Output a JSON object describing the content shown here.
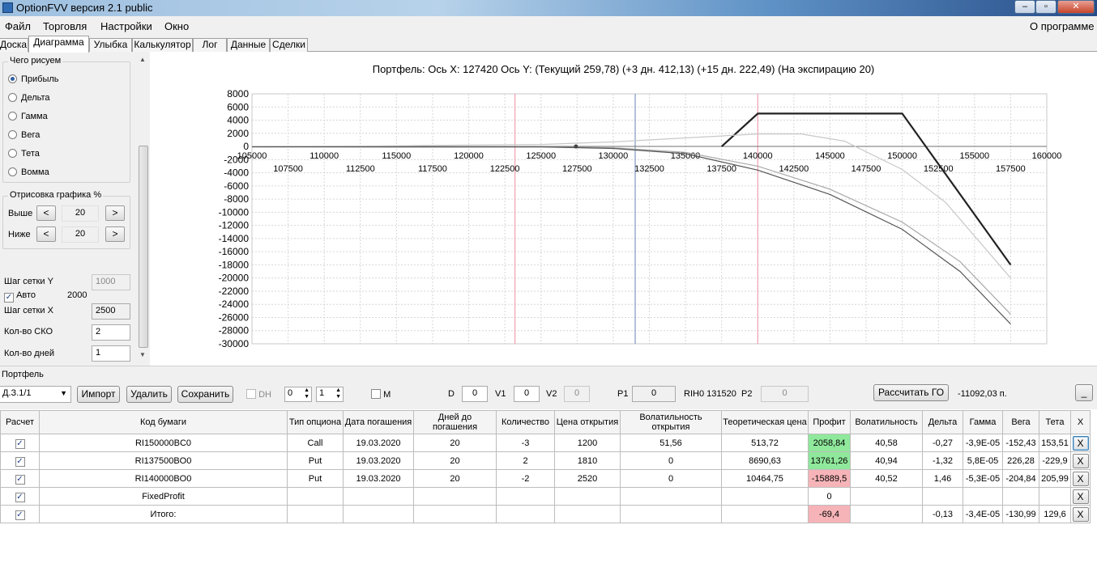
{
  "window": {
    "title": "OptionFVV версия 2.1 public",
    "min": "–",
    "max": "▫",
    "close": "✕"
  },
  "menu": {
    "items": [
      "Файл",
      "Торговля",
      "Настройки",
      "Окно"
    ],
    "about": "О программе"
  },
  "tabs": [
    "Доска",
    "Диаграмма",
    "Улыбка",
    "Калькулятор",
    "Лог",
    "Данные",
    "Сделки"
  ],
  "active_tab": "Диаграмма",
  "left_panel": {
    "draw_group_title": "Чего рисуем",
    "options": [
      "Прибыль",
      "Дельта",
      "Гамма",
      "Вега",
      "Тета",
      "Вомма"
    ],
    "selected": "Прибыль",
    "render_group_title": "Отрисовка графика %",
    "above_label": "Выше",
    "above_value": "20",
    "below_label": "Ниже",
    "below_value": "20",
    "btn_less": "<",
    "btn_more": ">",
    "grid_y_label": "Шаг сетки Y",
    "grid_y_value": "1000",
    "auto_label": "Авто",
    "auto_value": "2000",
    "grid_x_label": "Шаг сетки X",
    "grid_x_value": "2500",
    "sko_label": "Кол-во СКО",
    "sko_value": "2",
    "days_label": "Кол-во дней",
    "days_value": "1"
  },
  "chart_data": {
    "type": "line",
    "title": "Портфель: Ось X: 127420 Ось Y:  (Текущий 259,78)  (+3 дн. 412,13)  (+15 дн. 222,49)  (На экспирацию 20)",
    "xlabel": "",
    "ylabel": "",
    "xlim": [
      105000,
      160000
    ],
    "ylim": [
      -30000,
      8000
    ],
    "x_ticks_upper": [
      "105000",
      "110000",
      "115000",
      "120000",
      "125000",
      "130000",
      "135000",
      "140000",
      "145000",
      "150000",
      "155000",
      "160000"
    ],
    "x_ticks_lower": [
      "107500",
      "112500",
      "117500",
      "122500",
      "127500",
      "132500",
      "137500",
      "142500",
      "147500",
      "152500",
      "157500"
    ],
    "y_ticks": [
      "8000",
      "6000",
      "4000",
      "2000",
      "0",
      "-2000",
      "-4000",
      "-6000",
      "-8000",
      "-10000",
      "-12000",
      "-14000",
      "-16000",
      "-18000",
      "-20000",
      "-22000",
      "-24000",
      "-26000",
      "-28000",
      "-30000"
    ],
    "grid": true,
    "vlines": [
      {
        "x": 123200,
        "color": "#f4a0b0"
      },
      {
        "x": 131520,
        "color": "#7f98c0"
      },
      {
        "x": 140000,
        "color": "#f4a0b0"
      }
    ],
    "series": [
      {
        "color": "#222222",
        "x": [
          137500,
          140000,
          150000,
          157500
        ],
        "y": [
          0,
          5000,
          5000,
          -18000
        ]
      },
      {
        "color": "#c8c8c8",
        "x": [
          105000,
          115000,
          125000,
          130000,
          135000,
          140000,
          143000,
          146000,
          150000,
          153000,
          157500
        ],
        "y": [
          0,
          100,
          300,
          700,
          1300,
          1900,
          1900,
          800,
          -3500,
          -8500,
          -20000
        ]
      },
      {
        "color": "#a8a8a8",
        "x": [
          105000,
          115000,
          125000,
          130000,
          135000,
          140000,
          145000,
          150000,
          154000,
          157500
        ],
        "y": [
          -50,
          -60,
          -50,
          -200,
          -900,
          -3000,
          -6500,
          -11500,
          -17500,
          -25500
        ]
      },
      {
        "color": "#555555",
        "x": [
          105000,
          115000,
          125000,
          130000,
          135000,
          140000,
          145000,
          150000,
          154000,
          157500
        ],
        "y": [
          -50,
          -70,
          -80,
          -300,
          -1100,
          -3600,
          -7300,
          -12600,
          -19000,
          -27000
        ]
      }
    ]
  },
  "portfolio": {
    "section_label": "Портфель",
    "select_value": "Д.З.1/1",
    "import_label": "Импорт",
    "delete_label": "Удалить",
    "save_label": "Сохранить",
    "dh_label": "DH",
    "dh_spin1": "0",
    "dh_spin2": "1",
    "m_label": "M",
    "d_label": "D",
    "d_value": "0",
    "v1_label": "V1",
    "v1_value": "0",
    "v2_label": "V2",
    "v2_value": "0",
    "p1_label": "P1",
    "p1_value": "0",
    "rih_label": "RIH0 131520",
    "p2_label": "P2",
    "p2_value": "0",
    "calc_go_label": "Рассчитать ГО",
    "go_value": "-11092,03 п.",
    "collapse_label": "_"
  },
  "table": {
    "headers": [
      "Расчет",
      "Код бумаги",
      "Тип опциона",
      "Дата погашения",
      "Дней до погашения",
      "Количество",
      "Цена открытия",
      "Волатильность открытия",
      "Теоретическая цена",
      "Профит",
      "Волатильность",
      "Дельта",
      "Гамма",
      "Вега",
      "Тета",
      "X"
    ],
    "rows": [
      {
        "code": "RI150000BC0",
        "type": "Call",
        "date": "19.03.2020",
        "days": "20",
        "qty": "-3",
        "open_price": "1200",
        "open_vol": "51,56",
        "theor": "513,72",
        "profit": "2058,84",
        "profit_color": "green",
        "vol": "40,58",
        "delta": "-0,27",
        "gamma": "-3,9E-05",
        "vega": "-152,43",
        "theta": "153,51",
        "x": "X"
      },
      {
        "code": "RI137500BO0",
        "type": "Put",
        "date": "19.03.2020",
        "days": "20",
        "qty": "2",
        "open_price": "1810",
        "open_vol": "0",
        "theor": "8690,63",
        "profit": "13761,26",
        "profit_color": "green",
        "vol": "40,94",
        "delta": "-1,32",
        "gamma": "5,8E-05",
        "vega": "226,28",
        "theta": "-229,9",
        "x": "X"
      },
      {
        "code": "RI140000BO0",
        "type": "Put",
        "date": "19.03.2020",
        "days": "20",
        "qty": "-2",
        "open_price": "2520",
        "open_vol": "0",
        "theor": "10464,75",
        "profit": "-15889,5",
        "profit_color": "pink",
        "vol": "40,52",
        "delta": "1,46",
        "gamma": "-5,3E-05",
        "vega": "-204,84",
        "theta": "205,99",
        "x": "X"
      },
      {
        "code": "FixedProfit",
        "type": "",
        "date": "",
        "days": "",
        "qty": "",
        "open_price": "",
        "open_vol": "",
        "theor": "",
        "profit": "0",
        "profit_color": "",
        "vol": "",
        "delta": "",
        "gamma": "",
        "vega": "",
        "theta": "",
        "x": "X"
      },
      {
        "code": "Итого:",
        "type": "",
        "date": "",
        "days": "",
        "qty": "",
        "open_price": "",
        "open_vol": "",
        "theor": "",
        "profit": "-69,4",
        "profit_color": "pink",
        "vol": "",
        "delta": "-0,13",
        "gamma": "-3,4E-05",
        "vega": "-130,99",
        "theta": "129,6",
        "x": "X"
      }
    ]
  }
}
